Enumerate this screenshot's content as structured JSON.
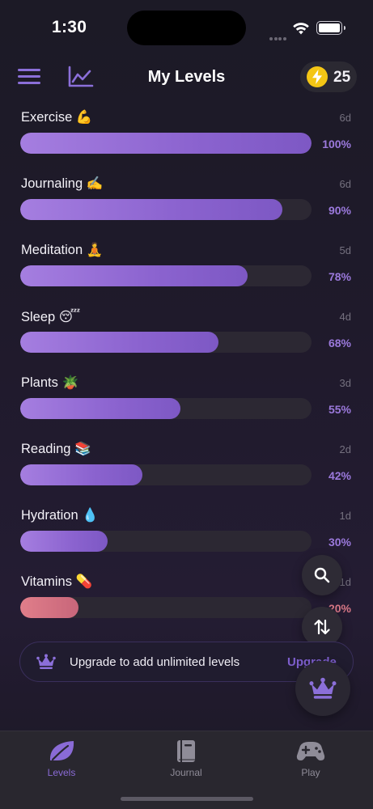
{
  "status_bar": {
    "time": "1:30"
  },
  "header": {
    "title": "My Levels",
    "coin_count": "25",
    "menu_icon": "hamburger-menu-icon",
    "stats_icon": "line-chart-icon",
    "coin_icon": "lightning-coin-icon"
  },
  "levels": [
    {
      "name": "Exercise 💪",
      "days": "6d",
      "percent_label": "100%",
      "progress": 1.0,
      "color": "#9b79dc"
    },
    {
      "name": "Journaling ✍️",
      "days": "6d",
      "percent_label": "90%",
      "progress": 0.9,
      "color": "#9b79dc"
    },
    {
      "name": "Meditation 🧘",
      "days": "5d",
      "percent_label": "78%",
      "progress": 0.78,
      "color": "#9b79dc"
    },
    {
      "name": "Sleep 😴",
      "days": "4d",
      "percent_label": "68%",
      "progress": 0.68,
      "color": "#9b79dc"
    },
    {
      "name": "Plants 🪴",
      "days": "3d",
      "percent_label": "55%",
      "progress": 0.55,
      "color": "#9b79dc"
    },
    {
      "name": "Reading 📚",
      "days": "2d",
      "percent_label": "42%",
      "progress": 0.42,
      "color": "#9b79dc"
    },
    {
      "name": "Hydration 💧",
      "days": "1d",
      "percent_label": "30%",
      "progress": 0.3,
      "color": "#9b79dc"
    },
    {
      "name": "Vitamins 💊",
      "days": "1d",
      "percent_label": "20%",
      "progress": 0.2,
      "color": "#d87886"
    }
  ],
  "upgrade": {
    "text": "Upgrade to add unlimited levels",
    "link": "Upgrade",
    "icon": "crown-icon"
  },
  "fabs": {
    "search_icon": "search-icon",
    "sort_icon": "sort-arrows-icon",
    "premium_icon": "crown-icon"
  },
  "tabs": [
    {
      "label": "Levels",
      "icon": "leaf-icon",
      "active": true
    },
    {
      "label": "Journal",
      "icon": "book-icon",
      "active": false
    },
    {
      "label": "Play",
      "icon": "gamepad-icon",
      "active": false
    }
  ],
  "colors": {
    "accent": "#8a6bd6",
    "background": "#1f1a2b",
    "coin": "#f4c615",
    "warning": "#d87886"
  }
}
